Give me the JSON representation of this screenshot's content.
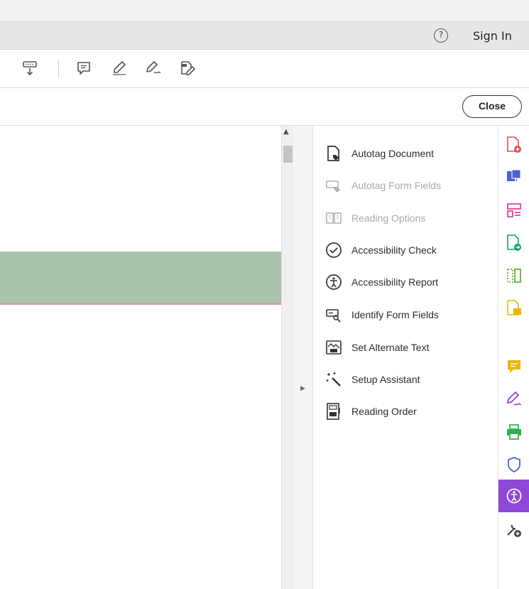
{
  "header": {
    "help_icon": "help-circle-icon",
    "help_glyph": "?",
    "sign_in_label": "Sign In"
  },
  "toolbar": {
    "icons": [
      "page-display-icon",
      "comment-icon",
      "highlight-pen-icon",
      "sign-icon",
      "edit-tag-icon"
    ]
  },
  "close_label": "Close",
  "document": {
    "band_color": "#abc4ae",
    "line_color": "#caa0a8"
  },
  "accessibility_tools": [
    {
      "label": "Autotag Document",
      "icon": "autotag-document-icon",
      "enabled": true
    },
    {
      "label": "Autotag Form Fields",
      "icon": "autotag-form-fields-icon",
      "enabled": false
    },
    {
      "label": "Reading Options",
      "icon": "reading-options-icon",
      "enabled": false
    },
    {
      "label": "Accessibility Check",
      "icon": "check-circle-icon",
      "enabled": true
    },
    {
      "label": "Accessibility Report",
      "icon": "accessibility-person-icon",
      "enabled": true
    },
    {
      "label": "Identify Form Fields",
      "icon": "identify-form-fields-icon",
      "enabled": true
    },
    {
      "label": "Set Alternate Text",
      "icon": "alternate-text-icon",
      "enabled": true
    },
    {
      "label": "Setup Assistant",
      "icon": "magic-wand-icon",
      "enabled": true
    },
    {
      "label": "Reading Order",
      "icon": "reading-order-icon",
      "enabled": true
    }
  ],
  "right_rail": [
    {
      "icon": "create-pdf-icon",
      "color": "#e34850"
    },
    {
      "icon": "export-pdf-icon",
      "color": "#4a5fd9"
    },
    {
      "icon": "organize-pages-icon",
      "color": "#e0388f"
    },
    {
      "icon": "send-pdf-icon",
      "color": "#12a07a"
    },
    {
      "icon": "compare-icon",
      "color": "#64b33e"
    },
    {
      "icon": "comment-pdf-icon",
      "color": "#e8b800"
    },
    {
      "icon": "comment-icon",
      "color": "#e8b800"
    },
    {
      "icon": "fill-sign-icon",
      "color": "#8e47d6"
    },
    {
      "icon": "print-production-icon",
      "color": "#2db24b"
    },
    {
      "icon": "protect-shield-icon",
      "color": "#4a5fd9"
    },
    {
      "icon": "accessibility-icon",
      "color": "#ffffff",
      "active": true
    },
    {
      "icon": "more-tools-icon",
      "color": "#444444"
    }
  ],
  "colors": {
    "accent": "#8e47d6",
    "text": "#2c2c2c",
    "disabled_text": "#a8a8a8"
  }
}
